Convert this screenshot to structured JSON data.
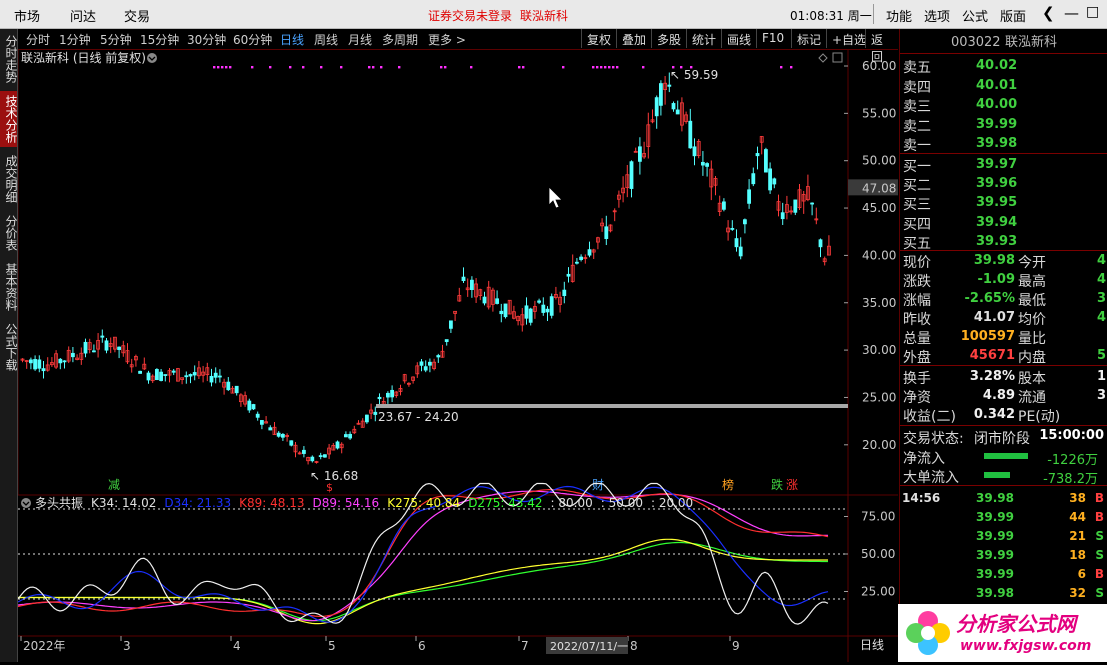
{
  "topbar": {
    "menu": [
      "市场",
      "问达",
      "交易"
    ],
    "notice": "证券交易未登录",
    "stock_label": "联泓新科",
    "time": "01:08:31 周一",
    "right_menu": [
      "功能",
      "选项",
      "公式",
      "版面"
    ]
  },
  "left_tabs": [
    "分时走势",
    "技术分析",
    "成交明细",
    "分价表",
    "基本资料",
    "公式下载"
  ],
  "periods": [
    "分时",
    "1分钟",
    "5分钟",
    "15分钟",
    "30分钟",
    "60分钟",
    "日线",
    "周线",
    "月线",
    "多周期",
    "更多 >"
  ],
  "tools": [
    "复权",
    "叠加",
    "多股",
    "统计",
    "画线",
    "F10",
    "标记",
    "+自选",
    "返回"
  ],
  "chart_title": "联泓新科 (日线 前复权)",
  "price_axis": [
    "60.00",
    "55.00",
    "50.00",
    "47.08",
    "45.00",
    "40.00",
    "35.00",
    "30.00",
    "25.00",
    "20.00"
  ],
  "annotations": {
    "high": "59.59",
    "low": "16.68",
    "range": "23.67 - 24.20"
  },
  "events": [
    "减",
    "$",
    "财",
    "榜",
    "跌",
    "涨"
  ],
  "indicator": {
    "name": "多头共振",
    "items": [
      {
        "label": "K34: 14.02",
        "color": "#e0e0e0"
      },
      {
        "label": "D34: 21.33",
        "color": "#1a2fff"
      },
      {
        "label": "K89: 48.13",
        "color": "#ff3030"
      },
      {
        "label": "D89: 54.16",
        "color": "#ff40ff"
      },
      {
        "label": "K275: 40.84",
        "color": "#ffff30"
      },
      {
        "label": "D275: 43.42",
        "color": "#30ff30"
      },
      {
        "label": ": 80.00",
        "color": "#e0e0e0"
      },
      {
        "label": ": 50.00",
        "color": "#e0e0e0"
      },
      {
        "label": ": 20.00",
        "color": "#e0e0e0"
      }
    ],
    "axis": [
      "75.00",
      "50.00",
      "25.00"
    ]
  },
  "date_axis": {
    "labels": [
      "2022年",
      "3",
      "4",
      "5",
      "6",
      "7",
      "8",
      "9"
    ],
    "cursor_date": "2022/07/11/一",
    "period_button": "日线"
  },
  "quote": {
    "code": "003022",
    "name": "联泓新科",
    "asks": [
      {
        "label": "卖五",
        "price": "40.02"
      },
      {
        "label": "卖四",
        "price": "40.01"
      },
      {
        "label": "卖三",
        "price": "40.00"
      },
      {
        "label": "卖二",
        "price": "39.99"
      },
      {
        "label": "卖一",
        "price": "39.98"
      }
    ],
    "bids": [
      {
        "label": "买一",
        "price": "39.97"
      },
      {
        "label": "买二",
        "price": "39.96"
      },
      {
        "label": "买三",
        "price": "39.95"
      },
      {
        "label": "买四",
        "price": "39.94"
      },
      {
        "label": "买五",
        "price": "39.93"
      }
    ],
    "stats": [
      {
        "l1": "现价",
        "v1": "39.98",
        "c1": "#40d040",
        "l2": "今开",
        "v2": "4"
      },
      {
        "l1": "涨跌",
        "v1": "-1.09",
        "c1": "#40d040",
        "l2": "最高",
        "v2": "4"
      },
      {
        "l1": "涨幅",
        "v1": "-2.65%",
        "c1": "#40d040",
        "l2": "最低",
        "v2": "3"
      },
      {
        "l1": "昨收",
        "v1": "41.07",
        "c1": "#e0e0e0",
        "l2": "均价",
        "v2": "4"
      },
      {
        "l1": "总量",
        "v1": "100597",
        "c1": "#ffb020",
        "l2": "量比",
        "v2": ""
      },
      {
        "l1": "外盘",
        "v1": "45671",
        "c1": "#ff4040",
        "l2": "内盘",
        "v2": "5"
      }
    ],
    "stats2": [
      {
        "l1": "换手",
        "v1": "3.28%",
        "l2": "股本",
        "v2": "1"
      },
      {
        "l1": "净资",
        "v1": "4.89",
        "l2": "流通",
        "v2": "3"
      },
      {
        "l1": "收益(二)",
        "v1": "0.342",
        "l2": "PE(动)",
        "v2": ""
      }
    ],
    "trade_state_label": "交易状态:",
    "trade_state": "闭市阶段",
    "trade_time": "15:00:00",
    "flows": [
      {
        "label": "净流入",
        "value": "-1226万"
      },
      {
        "label": "大单流入",
        "value": "-738.2万"
      }
    ],
    "ticks": [
      {
        "time": "14:56",
        "price": "39.98",
        "vol": "38",
        "side": "B"
      },
      {
        "time": "",
        "price": "39.99",
        "vol": "44",
        "side": "B"
      },
      {
        "time": "",
        "price": "39.99",
        "vol": "21",
        "side": "S"
      },
      {
        "time": "",
        "price": "39.99",
        "vol": "18",
        "side": "S"
      },
      {
        "time": "",
        "price": "39.99",
        "vol": "6",
        "side": "B"
      },
      {
        "time": "",
        "price": "39.98",
        "vol": "32",
        "side": "S"
      }
    ]
  },
  "watermark": {
    "text": "分析家公式网",
    "url": "www.fxjgsw.com"
  }
}
